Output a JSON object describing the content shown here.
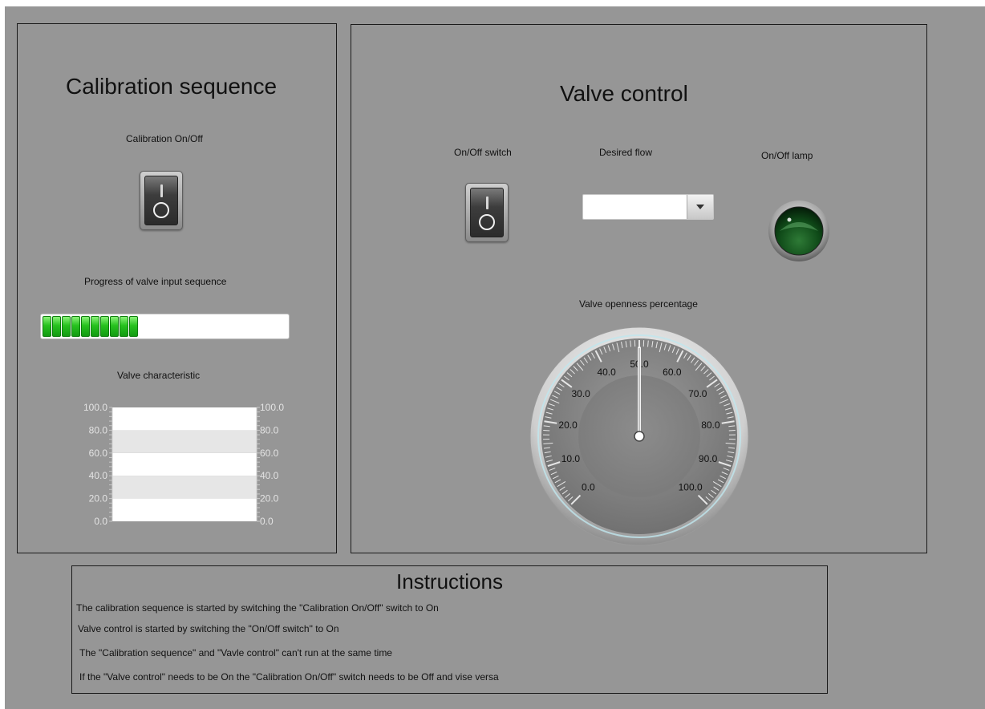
{
  "calibration": {
    "title": "Calibration sequence",
    "switch_label": "Calibration On/Off",
    "switch_state": "off",
    "progress_label": "Progress of valve input sequence",
    "progress_segments": 10,
    "progress_fraction": 0.49,
    "chart_title": "Valve characteristic"
  },
  "valve": {
    "title": "Valve control",
    "switch_label": "On/Off switch",
    "switch_state": "off",
    "flow_label": "Desired flow",
    "flow_value": "",
    "lamp_label": "On/Off lamp",
    "lamp_state": "off",
    "gauge_label": "Valve openness percentage",
    "gauge_value": 50.0,
    "gauge_min": 0.0,
    "gauge_max": 100.0,
    "gauge_ticks": [
      "0.0",
      "10.0",
      "20.0",
      "30.0",
      "40.0",
      "50.0",
      "60.0",
      "70.0",
      "80.0",
      "90.0",
      "100.0"
    ]
  },
  "instructions": {
    "title": "Instructions",
    "lines": [
      "The calibration sequence is started by switching the \"Calibration On/Off\" switch to On",
      "Valve control is started by switching the \"On/Off switch\" to On",
      "The \"Calibration sequence\" and \"Vavle control\" can't run at the same time",
      "If the \"Valve control\" needs to be On the \"Calibration On/Off\" switch needs to be Off and vise versa"
    ]
  },
  "colors": {
    "background": "#969696",
    "progress_green": "#27c21f",
    "lamp_off": "#0d3d12"
  },
  "chart_data": {
    "type": "line",
    "title": "",
    "ylim": [
      0.0,
      100.0
    ],
    "yticks": [
      "0.0",
      "20.0",
      "40.0",
      "60.0",
      "80.0",
      "100.0"
    ],
    "y2ticks": [
      "0.0",
      "20.0",
      "40.0",
      "60.0",
      "80.0",
      "100.0"
    ],
    "series": []
  }
}
